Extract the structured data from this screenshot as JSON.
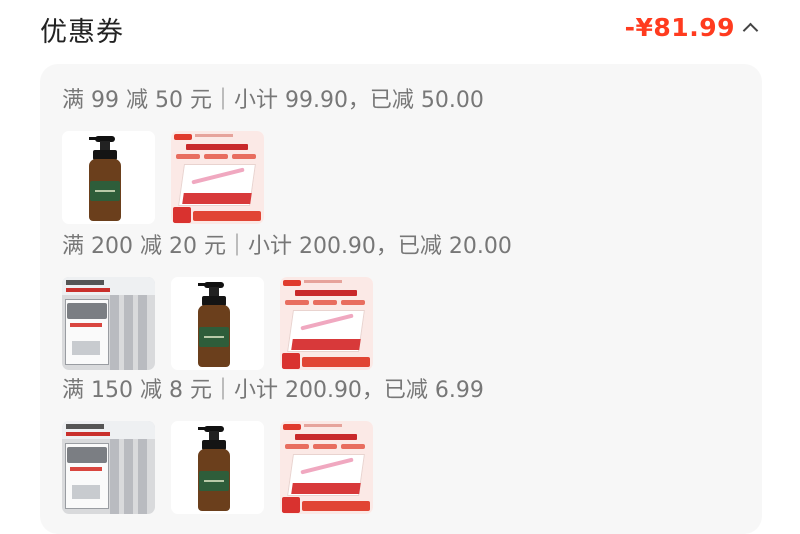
{
  "header": {
    "title": "优惠券",
    "total": "-¥81.99"
  },
  "groups": [
    {
      "title": "满 99 减 50 元｜小计 99.90，已减 50.00",
      "items": [
        "bottle",
        "box"
      ]
    },
    {
      "title": "满 200 减 20 元｜小计 200.90，已减 20.00",
      "items": [
        "curtain",
        "bottle",
        "box"
      ]
    },
    {
      "title": "满 150 减 8 元｜小计 200.90，已减 6.99",
      "items": [
        "curtain",
        "bottle",
        "box"
      ]
    }
  ],
  "colors": {
    "accent": "#ff3b1f",
    "panel": "#f7f7f7",
    "text_muted": "#777777"
  }
}
